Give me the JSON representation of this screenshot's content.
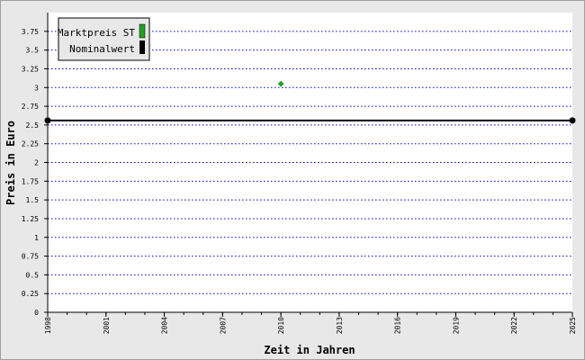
{
  "chart_data": {
    "type": "line",
    "xlabel": "Zeit in Jahren",
    "ylabel": "Preis in Euro",
    "xlim": [
      1998,
      2025
    ],
    "ylim": [
      0,
      4
    ],
    "x_ticks": [
      "1998",
      "2001",
      "2004",
      "2007",
      "2010",
      "2013",
      "2016",
      "2019",
      "2022",
      "2025"
    ],
    "y_ticks": [
      "0",
      "0.25",
      "0.5",
      "0.75",
      "1",
      "1.25",
      "1.5",
      "1.75",
      "2",
      "2.25",
      "2.5",
      "2.75",
      "3",
      "3.25",
      "3.5",
      "3.75"
    ],
    "grid": true,
    "legend_position": "top-left",
    "series": [
      {
        "name": "Marktpreis ST",
        "color": "#22a022",
        "marker": "diamond",
        "points": [
          {
            "x": 2010,
            "y": 3.05
          }
        ]
      },
      {
        "name": "Nominalwert",
        "color": "#000000",
        "marker": "circle",
        "points": [
          {
            "x": 1998,
            "y": 2.56
          },
          {
            "x": 2025,
            "y": 2.56
          }
        ]
      }
    ]
  }
}
